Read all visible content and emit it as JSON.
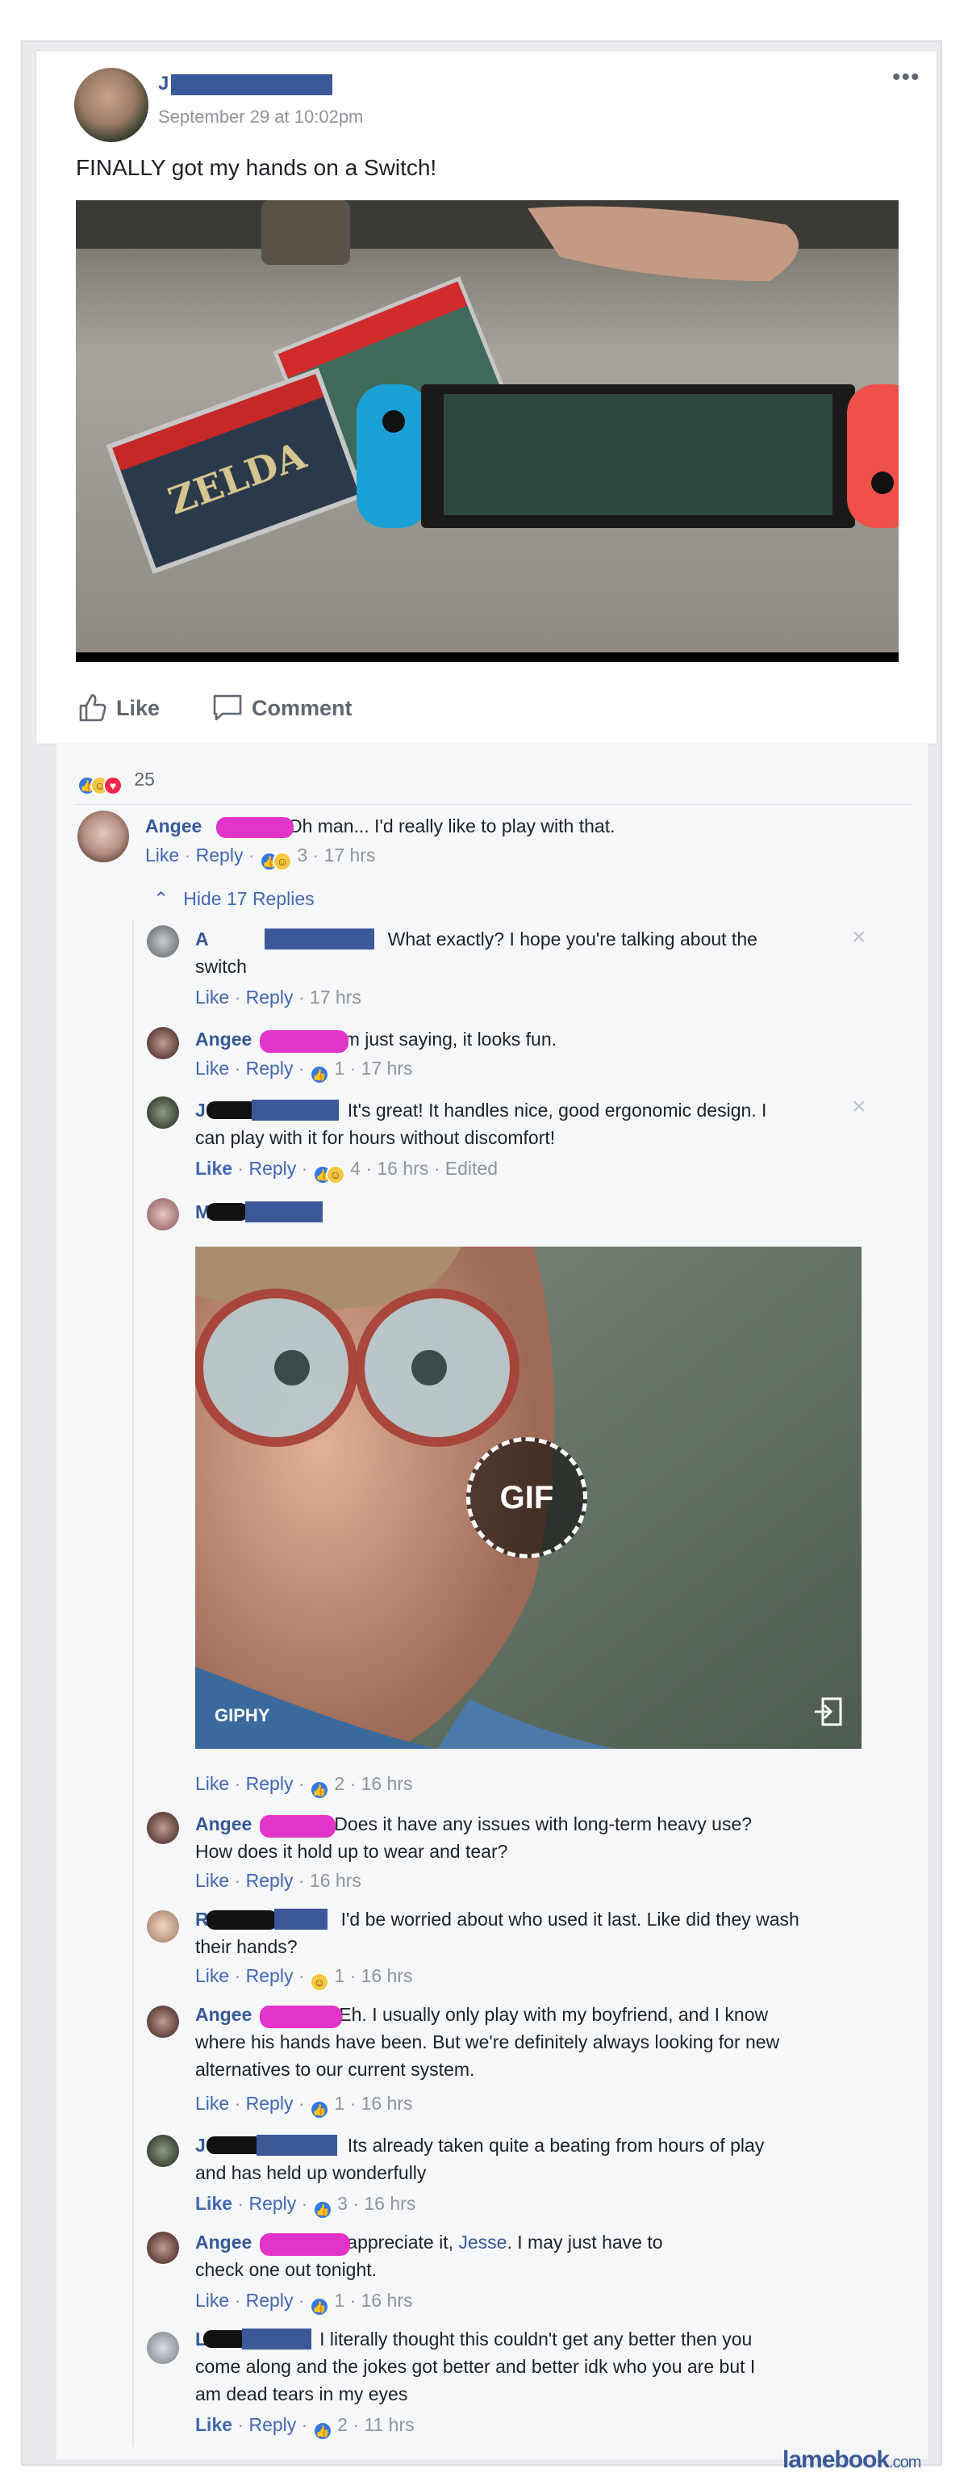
{
  "post": {
    "author_visible": "J",
    "timestamp": "September 29 at 10:02pm",
    "text": "FINALLY got my hands on a Switch!",
    "menu_icon": "more-dots-icon",
    "like_label": "Like",
    "comment_label": "Comment",
    "reaction_count": "25"
  },
  "thread": {
    "top_comment": {
      "name": "Angee",
      "text": "Oh man... I'd really like to play with that.",
      "like": "Like",
      "reply": "Reply",
      "reaction_count": "3",
      "time": "17 hrs"
    },
    "hide_replies_label": "Hide 17 Replies",
    "replies": [
      {
        "name": "A",
        "text_l1": "What exactly? I hope you're talking about the",
        "text_l2": "switch",
        "like": "Like",
        "reply": "Reply",
        "time": "17 hrs"
      },
      {
        "name": "Angee",
        "text_l1": "'m just saying, it looks fun.",
        "like": "Like",
        "reply": "Reply",
        "reaction_count": "1",
        "time": "17 hrs"
      },
      {
        "name": "J",
        "text_l1": "It's great! It handles nice, good ergonomic design. I",
        "text_l2": "can play with it for hours without discomfort!",
        "like": "Like",
        "reply": "Reply",
        "reaction_count": "4",
        "time": "16 hrs",
        "edited": "Edited"
      },
      {
        "name": "M",
        "gif_badge": "GIF",
        "gif_source": "GIPHY",
        "like": "Like",
        "reply": "Reply",
        "reaction_count": "2",
        "time": "16 hrs"
      },
      {
        "name": "Angee",
        "text_l1": "Does it have any issues with long-term heavy use?",
        "text_l2": "How does it hold up to wear and tear?",
        "like": "Like",
        "reply": "Reply",
        "time": "16 hrs"
      },
      {
        "name": "R",
        "text_l1": "I'd be worried about who used it last. Like did they wash",
        "text_l2": "their hands?",
        "like": "Like",
        "reply": "Reply",
        "reaction_count": "1",
        "time": "16 hrs"
      },
      {
        "name": "Angee",
        "text_l1": "Eh. I usually only play with my boyfriend, and I know",
        "text_l2": "where his hands have been. But we're definitely always looking for new",
        "text_l3": "alternatives to our current system.",
        "like": "Like",
        "reply": "Reply",
        "reaction_count": "1",
        "time": "16 hrs"
      },
      {
        "name": "J",
        "text_l1": "Its already taken quite a beating from hours of play",
        "text_l2": "and has held up wonderfully",
        "like": "Like",
        "reply": "Reply",
        "reaction_count": "3",
        "time": "16 hrs"
      },
      {
        "name": "Angee",
        "text_l1": "appreciate it, ",
        "mention": "Jesse",
        "text_l1b": ". I may just have to",
        "text_l2": "check one out tonight.",
        "like": "Like",
        "reply": "Reply",
        "reaction_count": "1",
        "time": "16 hrs"
      },
      {
        "name": "L",
        "text_l1": "I literally thought this couldn't get any better then you",
        "text_l2": "come along and the jokes got better and better idk who you are but I",
        "text_l3": "am dead tears in my eyes",
        "like": "Like",
        "reply": "Reply",
        "reaction_count": "2",
        "time": "11 hrs"
      }
    ]
  },
  "watermark": {
    "brand": "lamebook",
    "tld": ".com"
  },
  "colors": {
    "link": "#365899",
    "action": "#4267b2",
    "muted": "#90949c",
    "like_blue": "#3578e5",
    "haha_yellow": "#f7c744",
    "love_red": "#f0284a",
    "redact_pink": "#e234c8",
    "redact_blue": "#3b5998"
  }
}
